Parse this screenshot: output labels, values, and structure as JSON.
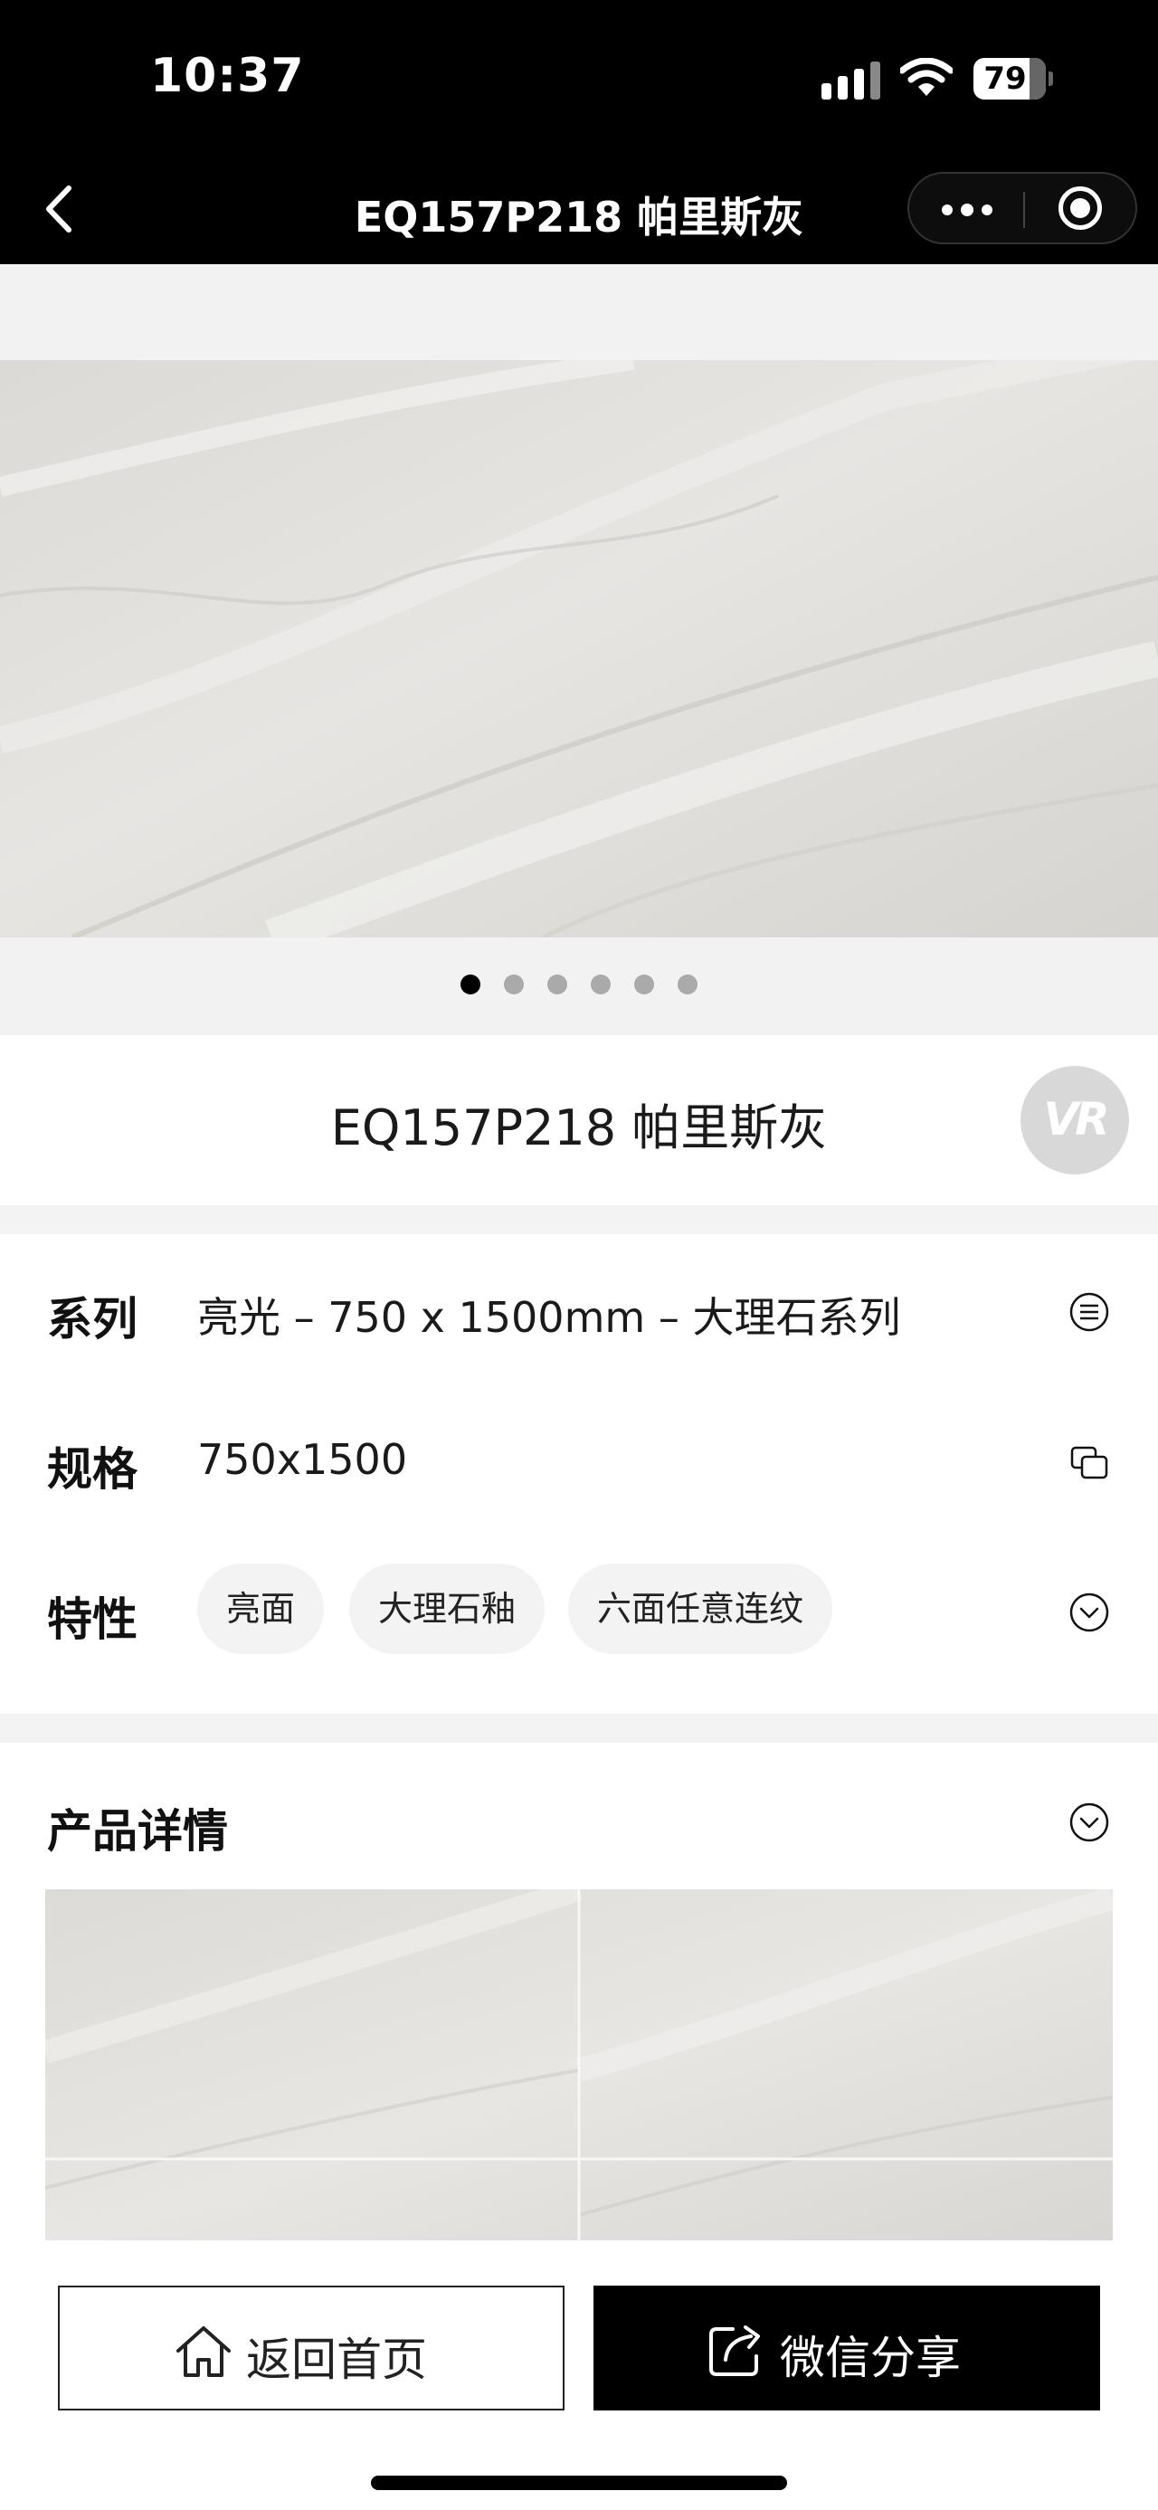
{
  "status_bar": {
    "time": "10:37",
    "battery": "79"
  },
  "nav": {
    "title": "EQ157P218 帕里斯灰"
  },
  "carousel": {
    "slide_count": 6,
    "active_index": 0
  },
  "product": {
    "title": "EQ157P218 帕里斯灰",
    "vr_label": "VR"
  },
  "attributes": {
    "series": {
      "label": "系列",
      "value": "亮光 – 750 x 1500mm – 大理石系列"
    },
    "spec": {
      "label": "规格",
      "value": "750x1500"
    },
    "features": {
      "label": "特性",
      "tags": [
        "亮面",
        "大理石釉",
        "六面任意连纹"
      ]
    }
  },
  "details": {
    "title": "产品详情"
  },
  "bottom_bar": {
    "home_label": "返回首页",
    "share_label": "微信分享"
  },
  "colors": {
    "accent": "#000000",
    "background": "#f3f3f3",
    "chip": "#f3f3f3",
    "vr_badge": "#d8d8d8"
  },
  "icons": [
    "chevron-left-icon",
    "more-icon",
    "target-icon",
    "list-icon",
    "copy-icon",
    "chevron-down-icon",
    "home-icon",
    "share-icon"
  ]
}
